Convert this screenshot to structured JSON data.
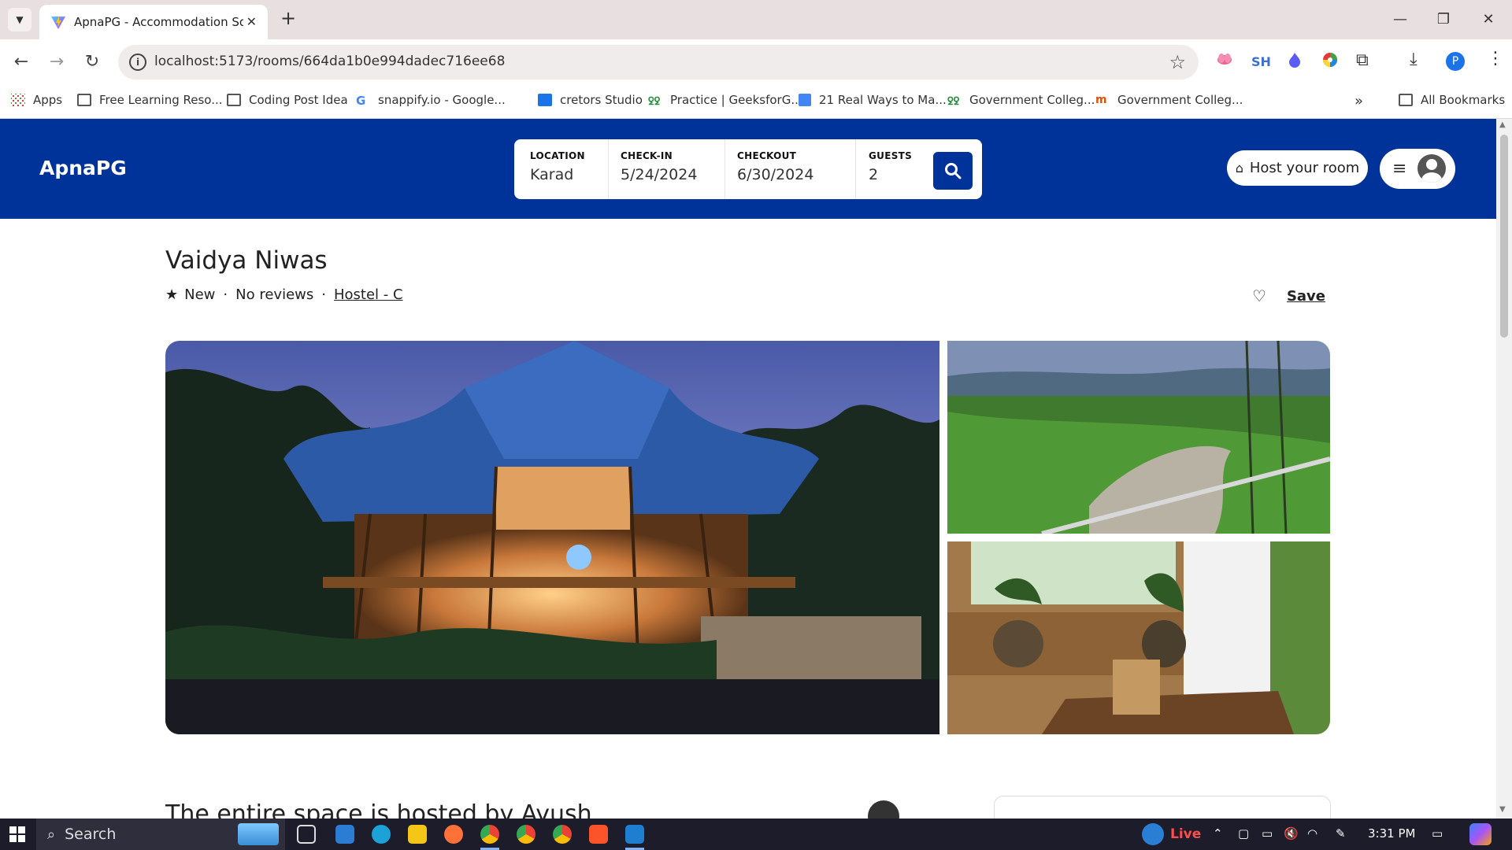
{
  "browser": {
    "tab_title": "ApnaPG - Accommodation Solu",
    "url": "localhost:5173/rooms/664da1b0e994dadec716ee68",
    "extensions": [
      "SH"
    ],
    "bookmarks": [
      {
        "label": "Apps",
        "icon": "apps-icon"
      },
      {
        "label": "Free Learning Reso...",
        "icon": "folder-icon"
      },
      {
        "label": "Coding Post Idea",
        "icon": "folder-icon"
      },
      {
        "label": "snappify.io - Google...",
        "icon": "google-icon"
      },
      {
        "label": "cretors Studio",
        "icon": "calendar-icon"
      },
      {
        "label": "Practice | GeeksforG...",
        "icon": "geeksforgeeks-icon"
      },
      {
        "label": "21 Real Ways to Ma...",
        "icon": "docs-icon"
      },
      {
        "label": "Government Colleg...",
        "icon": "geeksforgeeks-icon"
      },
      {
        "label": "Government Colleg...",
        "icon": "site-icon"
      }
    ],
    "all_bookmarks": "All Bookmarks"
  },
  "header": {
    "brand": "ApnaPG",
    "search": {
      "location_label": "LOCATION",
      "location_value": "Karad",
      "checkin_label": "CHECK-IN",
      "checkin_value": "5/24/2024",
      "checkout_label": "CHECKOUT",
      "checkout_value": "6/30/2024",
      "guests_label": "GUESTS",
      "guests_value": "2"
    },
    "host_button": "Host your room"
  },
  "room": {
    "title": "Vaidya Niwas",
    "rating": "New",
    "reviews": "No reviews",
    "category": "Hostel - C",
    "save_label": "Save",
    "host_heading": "The entire space is hosted by Ayush"
  },
  "taskbar": {
    "search_placeholder": "Search",
    "live_label": "Live",
    "time": "3:31 PM"
  },
  "colors": {
    "brand_blue": "#003399",
    "tab_bar": "#e8e0e0"
  }
}
